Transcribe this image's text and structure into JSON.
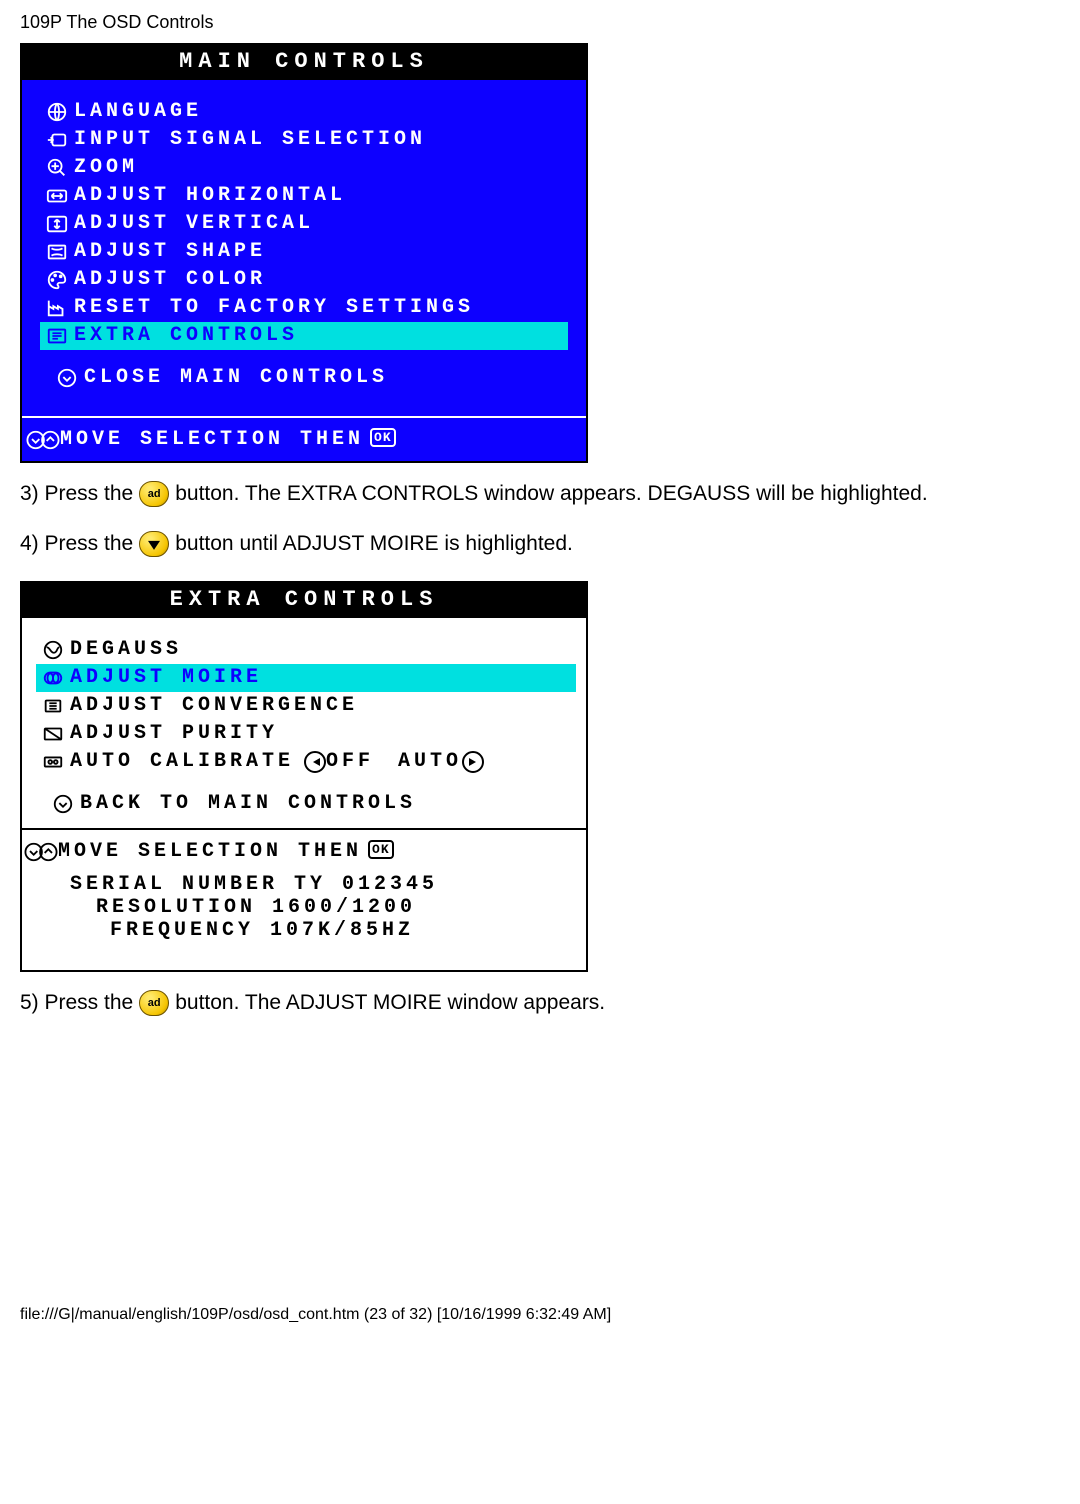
{
  "header": "109P The OSD Controls",
  "main_controls": {
    "title": "MAIN CONTROLS",
    "items": [
      {
        "label": "LANGUAGE",
        "icon": "language-icon"
      },
      {
        "label": "INPUT SIGNAL SELECTION",
        "icon": "input-icon"
      },
      {
        "label": "ZOOM",
        "icon": "zoom-icon"
      },
      {
        "label": "ADJUST HORIZONTAL",
        "icon": "horiz-icon"
      },
      {
        "label": "ADJUST VERTICAL",
        "icon": "vert-icon"
      },
      {
        "label": "ADJUST SHAPE",
        "icon": "shape-icon"
      },
      {
        "label": "ADJUST COLOR",
        "icon": "color-icon"
      },
      {
        "label": "RESET TO FACTORY SETTINGS",
        "icon": "reset-icon"
      },
      {
        "label": "EXTRA CONTROLS",
        "icon": "extra-icon",
        "selected": true
      }
    ],
    "close_label": "CLOSE MAIN CONTROLS",
    "footer": "MOVE SELECTION THEN",
    "footer_ok": "OK"
  },
  "step3": {
    "a": "3) Press the",
    "btn": "ad",
    "b": "button. The EXTRA CONTROLS window appears. DEGAUSS will be highlighted."
  },
  "step4": {
    "a": "4) Press the",
    "b": "button until ADJUST MOIRE is highlighted."
  },
  "extra_controls": {
    "title": "EXTRA CONTROLS",
    "items": [
      {
        "label": "DEGAUSS",
        "icon": "degauss-icon"
      },
      {
        "label": "ADJUST MOIRE",
        "icon": "moire-icon",
        "selected": true
      },
      {
        "label": "ADJUST CONVERGENCE",
        "icon": "converge-icon"
      },
      {
        "label": "ADJUST PURITY",
        "icon": "purity-icon"
      }
    ],
    "auto_calibrate": {
      "label": "AUTO CALIBRATE",
      "off": "OFF",
      "auto": "AUTO"
    },
    "back_label": "BACK TO MAIN CONTROLS",
    "footer": "MOVE SELECTION THEN",
    "footer_ok": "OK",
    "serial": "SERIAL NUMBER TY 012345",
    "resolution": "RESOLUTION 1600/1200",
    "frequency": "FREQUENCY 107K/85HZ"
  },
  "step5": {
    "a": "5) Press the",
    "btn": "ad",
    "b": "button. The ADJUST MOIRE window appears."
  },
  "footer": "file:///G|/manual/english/109P/osd/osd_cont.htm (23 of 32) [10/16/1999 6:32:49 AM]"
}
